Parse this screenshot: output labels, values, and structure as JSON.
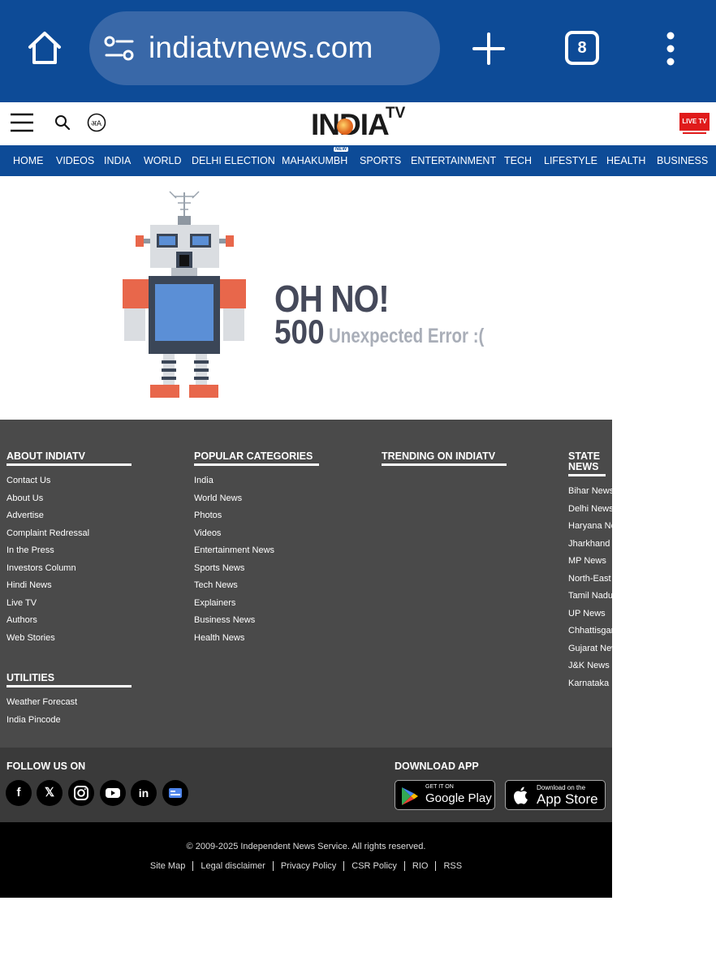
{
  "browser": {
    "url": "indiatvnews.com",
    "tab_count": "8"
  },
  "header": {
    "logo_text": "INDIA",
    "logo_tv": "TV",
    "live_tv_label": "LIVE TV"
  },
  "nav": {
    "items": [
      "HOME",
      "VIDEOS",
      "INDIA",
      "WORLD",
      "DELHI ELECTION",
      "MAHAKUMBH",
      "SPORTS",
      "ENTERTAINMENT",
      "TECH",
      "LIFESTYLE",
      "HEALTH",
      "BUSINESS"
    ],
    "new_badge": "NEW"
  },
  "error": {
    "headline": "OH NO!",
    "code": "500",
    "message": "Unexpected Error :("
  },
  "footer": {
    "about": {
      "title": "ABOUT INDIATV",
      "links": [
        "Contact Us",
        "About Us",
        "Advertise",
        "Complaint Redressal",
        "In the Press",
        "Investors Column",
        "Hindi News",
        "Live TV",
        "Authors",
        "Web Stories"
      ]
    },
    "popular": {
      "title": "POPULAR CATEGORIES",
      "links": [
        "India",
        "World News",
        "Photos",
        "Videos",
        "Entertainment News",
        "Sports News",
        "Tech News",
        "Explainers",
        "Business News",
        "Health News"
      ]
    },
    "trending": {
      "title": "TRENDING ON INDIATV"
    },
    "state": {
      "title_line1": "STATE",
      "title_line2": "NEWS",
      "links": [
        "Bihar News",
        "Delhi News",
        "Haryana News",
        "Jharkhand News",
        "MP News",
        "North-East News",
        "Tamil Nadu News",
        "UP News",
        "Chhattisgarh News",
        "Gujarat News",
        "J&K News",
        "Karnataka News"
      ]
    },
    "utilities": {
      "title": "UTILITIES",
      "links": [
        "Weather Forecast",
        "India Pincode"
      ]
    },
    "follow_title": "FOLLOW US ON",
    "download_title": "DOWNLOAD APP",
    "google_play_small": "GET IT ON",
    "google_play_big": "Google Play",
    "app_store_small": "Download on the",
    "app_store_big": "App Store",
    "copyright": "© 2009-2025 Independent News Service. All rights reserved.",
    "bottom_links": [
      "Site Map",
      "Legal disclaimer",
      "Privacy Policy",
      "CSR Policy",
      "RIO",
      "RSS"
    ]
  },
  "colors": {
    "brand_blue": "#0d4b97",
    "footer_grey": "#4a4a4a",
    "live_red": "#e01b1b"
  }
}
